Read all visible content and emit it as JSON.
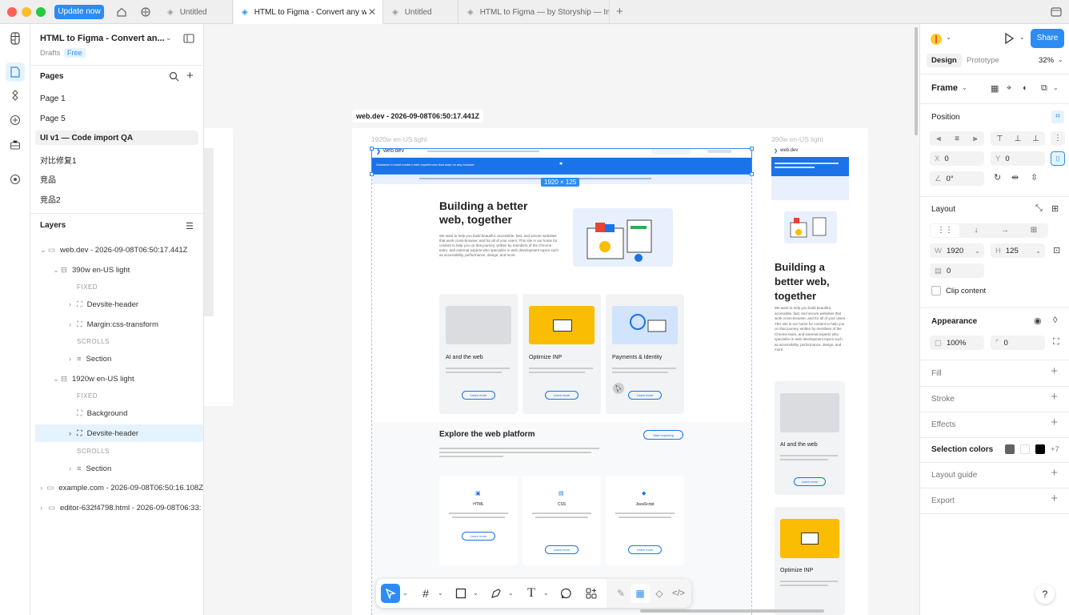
{
  "titlebar": {
    "update_label": "Update now",
    "tabs": [
      {
        "label": "Untitled",
        "active": false
      },
      {
        "label": "HTML to Figma - Convert any we",
        "active": true
      },
      {
        "label": "Untitled",
        "active": false
      },
      {
        "label": "HTML to Figma — by Storyship — Im;",
        "active": false
      }
    ],
    "new_tab": "+"
  },
  "file": {
    "title": "HTML to Figma - Convert an...",
    "drafts": "Drafts",
    "plan": "Free"
  },
  "pages": {
    "heading": "Pages",
    "items": [
      "Page 1",
      "Page 5",
      "UI v1 — Code import QA",
      "对比修复1",
      "竞品",
      "竞品2"
    ]
  },
  "layers": {
    "heading": "Layers",
    "items": [
      {
        "label": "web.dev - 2026-09-08T06:50:17.441Z"
      },
      {
        "label": "390w en-US light"
      },
      {
        "label": "FIXED"
      },
      {
        "label": "Devsite-header"
      },
      {
        "label": "Margin:css-transform"
      },
      {
        "label": "SCROLLS"
      },
      {
        "label": "Section"
      },
      {
        "label": "1920w en-US light"
      },
      {
        "label": "FIXED"
      },
      {
        "label": "Background"
      },
      {
        "label": "Devsite-header"
      },
      {
        "label": "SCROLLS"
      },
      {
        "label": "Section"
      },
      {
        "label": "example.com - 2026-09-08T06:50:16.108Z"
      },
      {
        "label": "editor-632f4798.html - 2026-09-08T06:33:"
      }
    ]
  },
  "canvas": {
    "frame_label": "web.dev - 2026-09-08T06:50:17.441Z",
    "frame_1920": "1920w en-US light",
    "frame_390": "390w en-US light",
    "size_badge": "1920 × 125",
    "page": {
      "logo": "web.dev",
      "banner": "Guidance to build modern web experiences that work on any browser.",
      "hero_title": "Building a better web, together",
      "hero_title_mobile": "Building a better web, together",
      "hero_body": "We want to help you build beautiful, accessible, fast, and secure websites that work cross-browser, and for all of your users. This site is our home for content to help you on that journey, written by members of the Chrome team, and external experts who specialize in web development topics such as accessibility, performance, design, and more.",
      "cards": [
        {
          "title": "AI and the web",
          "btn": "Learn more"
        },
        {
          "title": "Optimize INP",
          "btn": "Learn more"
        },
        {
          "title": "Payments & Identity",
          "btn": "Learn more"
        }
      ],
      "explore_title": "Explore the web platform",
      "explore_btn": "Start exploring",
      "explore_body": "The web platform is a constantly evolving ecosystem of browser features and APIs for developers to make websites that are easy and delightful to use. These pages are pathways for you to dive into each part of the web platform on web.dev—all your peers.",
      "tech": [
        {
          "title": "HTML",
          "btn": "Learn more"
        },
        {
          "title": "CSS",
          "btn": "Learn more"
        },
        {
          "title": "JavaScript",
          "btn": "Learn more"
        }
      ]
    }
  },
  "right": {
    "share": "Share",
    "tabs": [
      "Design",
      "Prototype"
    ],
    "zoom": "32%",
    "frame": "Frame",
    "position": "Position",
    "x_label": "X",
    "x": "0",
    "y_label": "Y",
    "y": "0",
    "rotation": "0°",
    "layout": "Layout",
    "w_label": "W",
    "w": "1920",
    "h_label": "H",
    "h": "125",
    "gap": "0",
    "clip": "Clip content",
    "appearance": "Appearance",
    "opacity": "100%",
    "radius": "0",
    "fill": "Fill",
    "stroke": "Stroke",
    "effects": "Effects",
    "selection_colors": "Selection colors",
    "sel_more": "+7",
    "layout_guide": "Layout guide",
    "export": "Export",
    "help": "?"
  },
  "colors": {
    "accent": "#2c8cf4",
    "selection": "#e5f3fe",
    "banner_blue": "#1a73e8"
  }
}
